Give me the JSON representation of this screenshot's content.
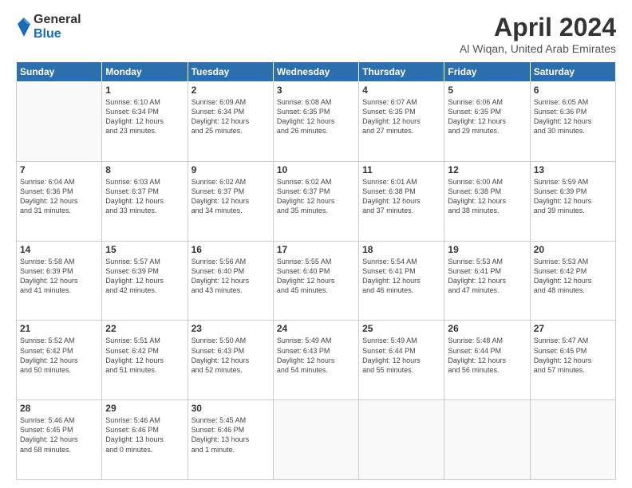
{
  "logo": {
    "general": "General",
    "blue": "Blue"
  },
  "title": {
    "month": "April 2024",
    "location": "Al Wiqan, United Arab Emirates"
  },
  "headers": [
    "Sunday",
    "Monday",
    "Tuesday",
    "Wednesday",
    "Thursday",
    "Friday",
    "Saturday"
  ],
  "weeks": [
    [
      {
        "day": "",
        "info": ""
      },
      {
        "day": "1",
        "info": "Sunrise: 6:10 AM\nSunset: 6:34 PM\nDaylight: 12 hours\nand 23 minutes."
      },
      {
        "day": "2",
        "info": "Sunrise: 6:09 AM\nSunset: 6:34 PM\nDaylight: 12 hours\nand 25 minutes."
      },
      {
        "day": "3",
        "info": "Sunrise: 6:08 AM\nSunset: 6:35 PM\nDaylight: 12 hours\nand 26 minutes."
      },
      {
        "day": "4",
        "info": "Sunrise: 6:07 AM\nSunset: 6:35 PM\nDaylight: 12 hours\nand 27 minutes."
      },
      {
        "day": "5",
        "info": "Sunrise: 6:06 AM\nSunset: 6:35 PM\nDaylight: 12 hours\nand 29 minutes."
      },
      {
        "day": "6",
        "info": "Sunrise: 6:05 AM\nSunset: 6:36 PM\nDaylight: 12 hours\nand 30 minutes."
      }
    ],
    [
      {
        "day": "7",
        "info": "Sunrise: 6:04 AM\nSunset: 6:36 PM\nDaylight: 12 hours\nand 31 minutes."
      },
      {
        "day": "8",
        "info": "Sunrise: 6:03 AM\nSunset: 6:37 PM\nDaylight: 12 hours\nand 33 minutes."
      },
      {
        "day": "9",
        "info": "Sunrise: 6:02 AM\nSunset: 6:37 PM\nDaylight: 12 hours\nand 34 minutes."
      },
      {
        "day": "10",
        "info": "Sunrise: 6:02 AM\nSunset: 6:37 PM\nDaylight: 12 hours\nand 35 minutes."
      },
      {
        "day": "11",
        "info": "Sunrise: 6:01 AM\nSunset: 6:38 PM\nDaylight: 12 hours\nand 37 minutes."
      },
      {
        "day": "12",
        "info": "Sunrise: 6:00 AM\nSunset: 6:38 PM\nDaylight: 12 hours\nand 38 minutes."
      },
      {
        "day": "13",
        "info": "Sunrise: 5:59 AM\nSunset: 6:39 PM\nDaylight: 12 hours\nand 39 minutes."
      }
    ],
    [
      {
        "day": "14",
        "info": "Sunrise: 5:58 AM\nSunset: 6:39 PM\nDaylight: 12 hours\nand 41 minutes."
      },
      {
        "day": "15",
        "info": "Sunrise: 5:57 AM\nSunset: 6:39 PM\nDaylight: 12 hours\nand 42 minutes."
      },
      {
        "day": "16",
        "info": "Sunrise: 5:56 AM\nSunset: 6:40 PM\nDaylight: 12 hours\nand 43 minutes."
      },
      {
        "day": "17",
        "info": "Sunrise: 5:55 AM\nSunset: 6:40 PM\nDaylight: 12 hours\nand 45 minutes."
      },
      {
        "day": "18",
        "info": "Sunrise: 5:54 AM\nSunset: 6:41 PM\nDaylight: 12 hours\nand 46 minutes."
      },
      {
        "day": "19",
        "info": "Sunrise: 5:53 AM\nSunset: 6:41 PM\nDaylight: 12 hours\nand 47 minutes."
      },
      {
        "day": "20",
        "info": "Sunrise: 5:53 AM\nSunset: 6:42 PM\nDaylight: 12 hours\nand 48 minutes."
      }
    ],
    [
      {
        "day": "21",
        "info": "Sunrise: 5:52 AM\nSunset: 6:42 PM\nDaylight: 12 hours\nand 50 minutes."
      },
      {
        "day": "22",
        "info": "Sunrise: 5:51 AM\nSunset: 6:42 PM\nDaylight: 12 hours\nand 51 minutes."
      },
      {
        "day": "23",
        "info": "Sunrise: 5:50 AM\nSunset: 6:43 PM\nDaylight: 12 hours\nand 52 minutes."
      },
      {
        "day": "24",
        "info": "Sunrise: 5:49 AM\nSunset: 6:43 PM\nDaylight: 12 hours\nand 54 minutes."
      },
      {
        "day": "25",
        "info": "Sunrise: 5:49 AM\nSunset: 6:44 PM\nDaylight: 12 hours\nand 55 minutes."
      },
      {
        "day": "26",
        "info": "Sunrise: 5:48 AM\nSunset: 6:44 PM\nDaylight: 12 hours\nand 56 minutes."
      },
      {
        "day": "27",
        "info": "Sunrise: 5:47 AM\nSunset: 6:45 PM\nDaylight: 12 hours\nand 57 minutes."
      }
    ],
    [
      {
        "day": "28",
        "info": "Sunrise: 5:46 AM\nSunset: 6:45 PM\nDaylight: 12 hours\nand 58 minutes."
      },
      {
        "day": "29",
        "info": "Sunrise: 5:46 AM\nSunset: 6:46 PM\nDaylight: 13 hours\nand 0 minutes."
      },
      {
        "day": "30",
        "info": "Sunrise: 5:45 AM\nSunset: 6:46 PM\nDaylight: 13 hours\nand 1 minute."
      },
      {
        "day": "",
        "info": ""
      },
      {
        "day": "",
        "info": ""
      },
      {
        "day": "",
        "info": ""
      },
      {
        "day": "",
        "info": ""
      }
    ]
  ]
}
